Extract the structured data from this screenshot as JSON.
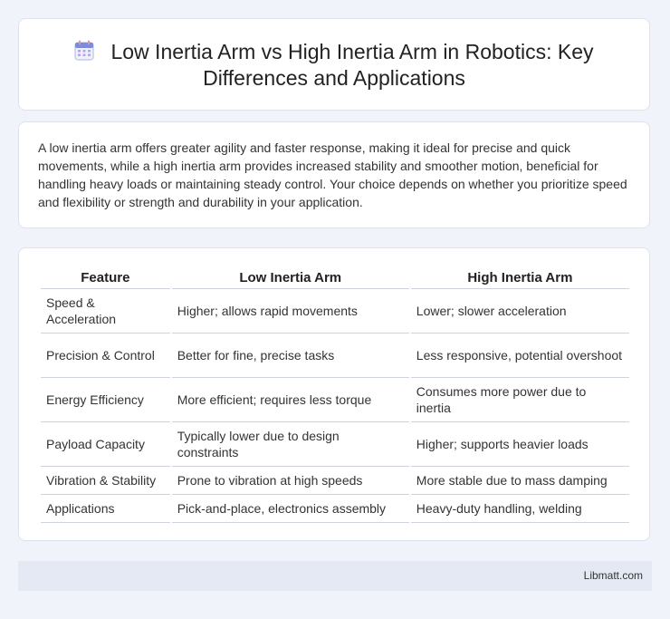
{
  "header": {
    "icon": "calendar-icon",
    "title_line1": "Low Inertia Arm vs High Inertia Arm in Robotics: Key",
    "title_line2": "Differences and Applications"
  },
  "summary": "A low inertia arm offers greater agility and faster response, making it ideal for precise and quick movements, while a high inertia arm provides increased stability and smoother motion, beneficial for handling heavy loads or maintaining steady control. Your choice depends on whether you prioritize speed and flexibility or strength and durability in your application.",
  "table": {
    "headers": [
      "Feature",
      "Low Inertia Arm",
      "High Inertia Arm"
    ],
    "rows": [
      [
        "Speed & Acceleration",
        "Higher; allows rapid movements",
        "Lower; slower acceleration"
      ],
      [
        "Precision & Control",
        "Better for fine, precise tasks",
        "Less responsive, potential overshoot"
      ],
      [
        "Energy Efficiency",
        "More efficient; requires less torque",
        "Consumes more power due to inertia"
      ],
      [
        "Payload Capacity",
        "Typically lower due to design constraints",
        "Higher; supports heavier loads"
      ],
      [
        "Vibration & Stability",
        "Prone to vibration at high speeds",
        "More stable due to mass damping"
      ],
      [
        "Applications",
        "Pick-and-place, electronics assembly",
        "Heavy-duty handling, welding"
      ]
    ]
  },
  "footer": {
    "brand": "Libmatt.com"
  },
  "colors": {
    "background": "#f0f3f9",
    "card": "#ffffff",
    "footer": "#e4e9f4",
    "icon_accent": "#7b8ce0"
  }
}
